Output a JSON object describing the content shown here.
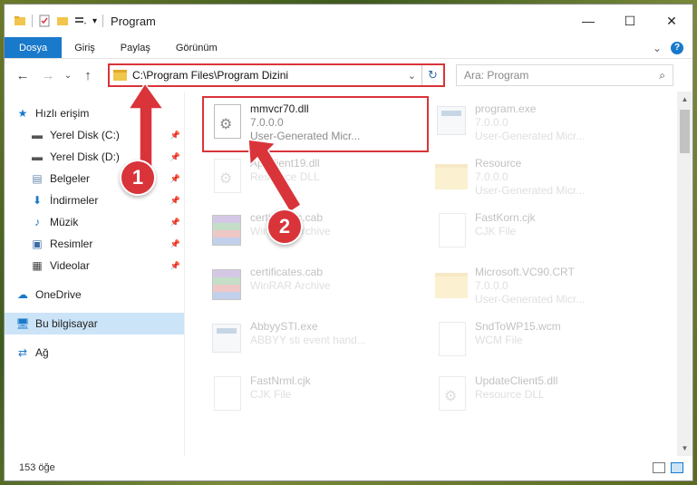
{
  "titlebar": {
    "title": "Program",
    "minimize": "—",
    "maximize": "☐",
    "close": "✕"
  },
  "ribbon": {
    "tabs": [
      "Dosya",
      "Giriş",
      "Paylaş",
      "Görünüm"
    ],
    "expand": "⌄",
    "help": "?"
  },
  "nav": {
    "back": "←",
    "forward": "→",
    "dropdown": "⌄",
    "up": "↑"
  },
  "address": {
    "path": "C:\\Program Files\\Program Dizini",
    "dropdown": "⌄",
    "refresh": "↻"
  },
  "search": {
    "placeholder": "Ara: Program",
    "icon": "⌕"
  },
  "sidebar": {
    "quick_access": "Hızlı erişim",
    "items": [
      {
        "label": "Yerel Disk (C:)",
        "icon": "drive-icon"
      },
      {
        "label": "Yerel Disk (D:)",
        "icon": "drive-icon"
      },
      {
        "label": "Belgeler",
        "icon": "documents-icon"
      },
      {
        "label": "İndirmeler",
        "icon": "download-icon"
      },
      {
        "label": "Müzik",
        "icon": "music-icon"
      },
      {
        "label": "Resimler",
        "icon": "pictures-icon"
      },
      {
        "label": "Videolar",
        "icon": "video-icon"
      }
    ],
    "pin": "📌",
    "onedrive": "OneDrive",
    "this_pc": "Bu bilgisayar",
    "network": "Ağ"
  },
  "files": [
    {
      "name": "mmvcr70.dll",
      "line2": "7.0.0.0",
      "line3": "User-Generated Micr...",
      "icon": "dll"
    },
    {
      "name": "program.exe",
      "line2": "7.0.0.0",
      "line3": "User-Generated Micr...",
      "icon": "exe"
    },
    {
      "name": "ApiClient19.dll",
      "line2": "Resource DLL",
      "line3": "",
      "icon": "dll"
    },
    {
      "name": "Resource",
      "line2": "7.0.0.0",
      "line3": "User-Generated Micr...",
      "icon": "folder"
    },
    {
      "name": "certificates.cab",
      "line2": "WinRAR Archive",
      "line3": "",
      "icon": "rar"
    },
    {
      "name": "FastKorn.cjk",
      "line2": "CJK File",
      "line3": "",
      "icon": "doc"
    },
    {
      "name": "certificates.cab",
      "line2": "WinRAR Archive",
      "line3": "",
      "icon": "rar"
    },
    {
      "name": "Microsoft.VC90.CRT",
      "line2": "7.0.0.0",
      "line3": "User-Generated Micr...",
      "icon": "folder"
    },
    {
      "name": "AbbyySTI.exe",
      "line2": "ABBYY sti event hand...",
      "line3": "",
      "icon": "exe"
    },
    {
      "name": "SndToWP15.wcm",
      "line2": "WCM File",
      "line3": "",
      "icon": "doc"
    },
    {
      "name": "FastNrml.cjk",
      "line2": "CJK File",
      "line3": "",
      "icon": "doc"
    },
    {
      "name": "UpdateClient5.dll",
      "line2": "Resource DLL",
      "line3": "",
      "icon": "dll"
    }
  ],
  "status": {
    "count": "153 öğe"
  },
  "annotations": {
    "step1": "1",
    "step2": "2",
    "color": "#d9343a"
  },
  "colors": {
    "accent": "#1979ca",
    "highlight": "#d9343a"
  }
}
